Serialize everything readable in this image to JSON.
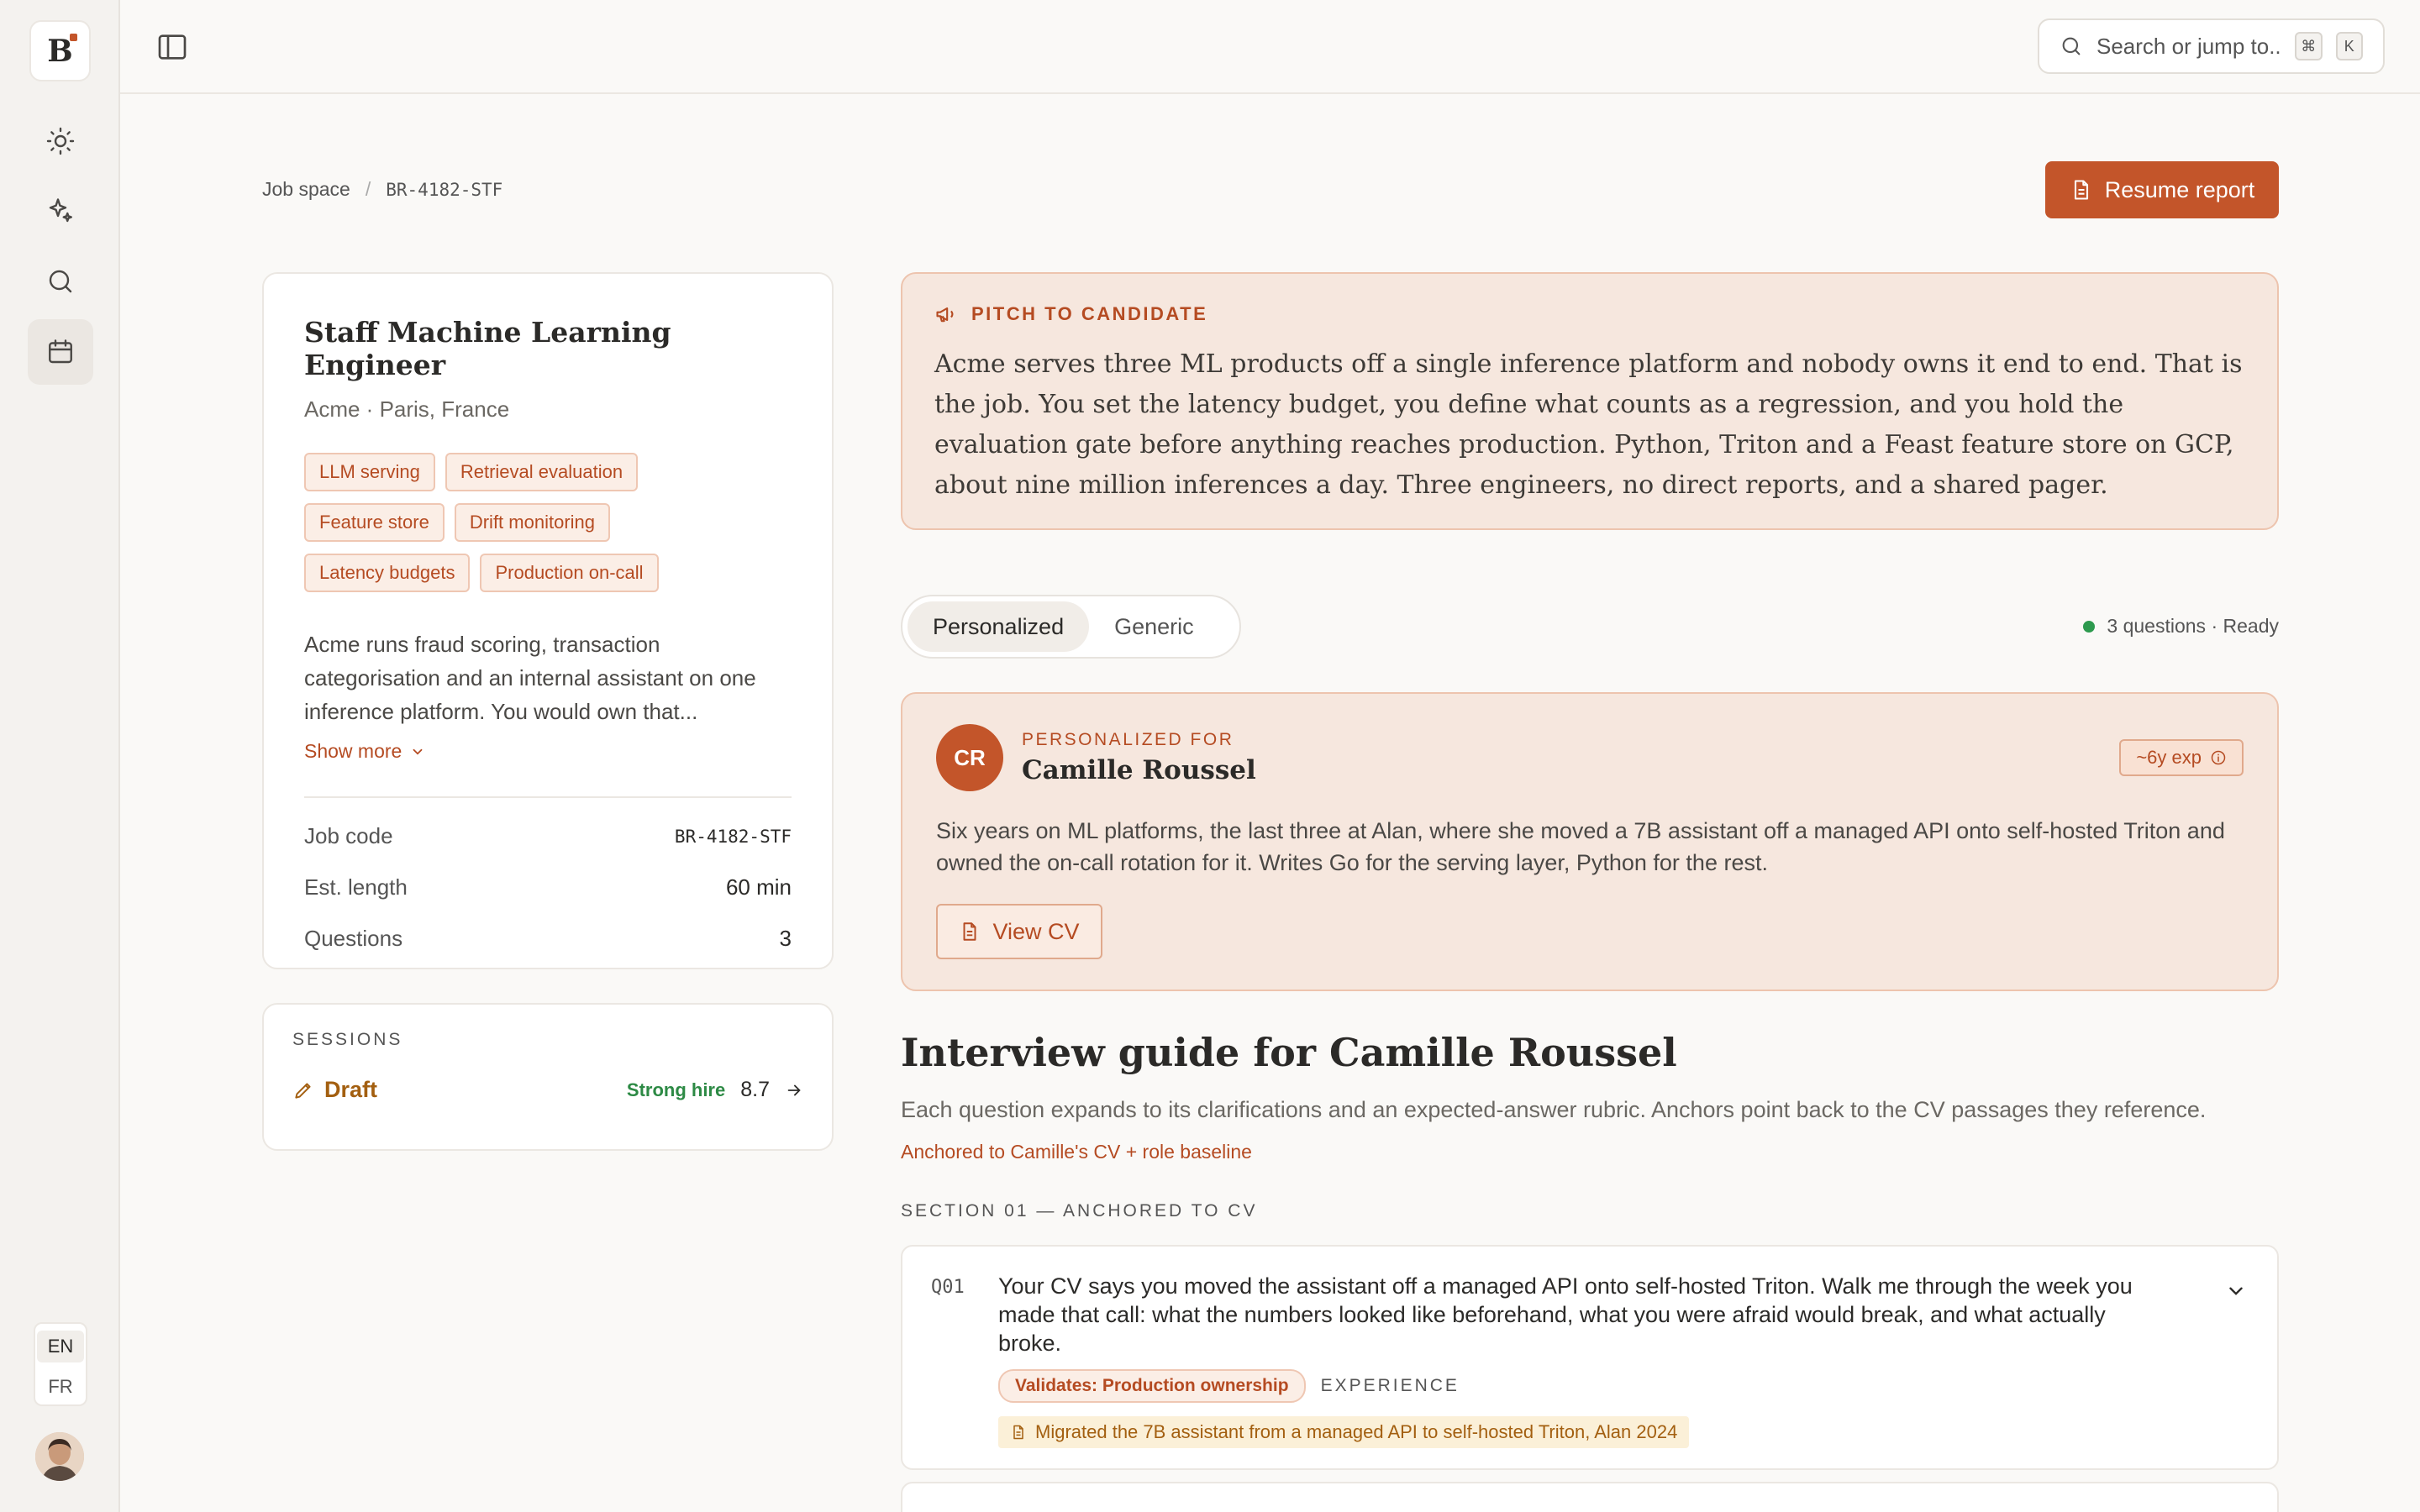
{
  "sidebar": {
    "logo_letter": "B",
    "nav": [
      "sun-icon",
      "sparkle-icon",
      "search-icon",
      "calendar-icon"
    ],
    "languages": [
      "EN",
      "FR"
    ],
    "active_language": "EN"
  },
  "topbar": {
    "search_placeholder": "Search or jump to...",
    "shortcut": [
      "⌘",
      "K"
    ]
  },
  "breadcrumb": {
    "parent": "Job space",
    "separator": "/",
    "current": "BR-4182-STF"
  },
  "actions": {
    "resume_report": "Resume report"
  },
  "job": {
    "title": "Staff Machine Learning Engineer",
    "location": "Acme · Paris, France",
    "tags": [
      "LLM serving",
      "Retrieval evaluation",
      "Feature store",
      "Drift monitoring",
      "Latency budgets",
      "Production on-call"
    ],
    "description": "Acme runs fraud scoring, transaction categorisation and an internal assistant on one inference platform. You would own that...",
    "show_more": "Show more",
    "fields": [
      {
        "label": "Job code",
        "value": "BR-4182-STF"
      },
      {
        "label": "Est. length",
        "value": "60 min"
      },
      {
        "label": "Questions",
        "value": "3"
      }
    ]
  },
  "sessions": {
    "label": "SESSIONS",
    "items": [
      {
        "status": "Draft",
        "verdict": "Strong hire",
        "score": "8.7"
      }
    ]
  },
  "pitch": {
    "label": "PITCH TO CANDIDATE",
    "body": "Acme serves three ML products off a single inference platform and nobody owns it end to end. That is the job. You set the latency budget, you define what counts as a regression, and you hold the evaluation gate before anything reaches production. Python, Triton and a Feast feature store on GCP, about nine million inferences a day. Three engineers, no direct reports, and a shared pager."
  },
  "tabs": {
    "items": [
      "Personalized",
      "Generic"
    ],
    "active": "Personalized",
    "status": "3 questions · Ready"
  },
  "candidate": {
    "eyebrow": "PERSONALIZED FOR",
    "initials": "CR",
    "name": "Camille Roussel",
    "experience": "~6y exp",
    "summary": "Six years on ML platforms, the last three at Alan, where she moved a 7B assistant off a managed API onto self-hosted Triton and owned the on-call rotation for it. Writes Go for the serving layer, Python for the rest.",
    "view_cv": "View CV"
  },
  "guide": {
    "title": "Interview guide for Camille Roussel",
    "subtitle": "Each question expands to its clarifications and an expected-answer rubric. Anchors point back to the CV passages they reference.",
    "anchor_note": "Anchored to Camille's CV + role baseline",
    "section_label": "SECTION 01 — ANCHORED TO CV",
    "questions": [
      {
        "num": "Q01",
        "text": "Your CV says you moved the assistant off a managed API onto self-hosted Triton. Walk me through the week you made that call: what the numbers looked like beforehand, what you were afraid would break, and what actually broke.",
        "validates": "Validates: Production ownership",
        "kind": "EXPERIENCE",
        "cv_anchor": "Migrated the 7B assistant from a managed API to self-hosted Triton, Alan 2024"
      }
    ]
  },
  "colors": {
    "accent": "#c3552a",
    "accent_soft": "#f6e7de",
    "success": "#2d9a4e",
    "warning": "#a35f10"
  }
}
